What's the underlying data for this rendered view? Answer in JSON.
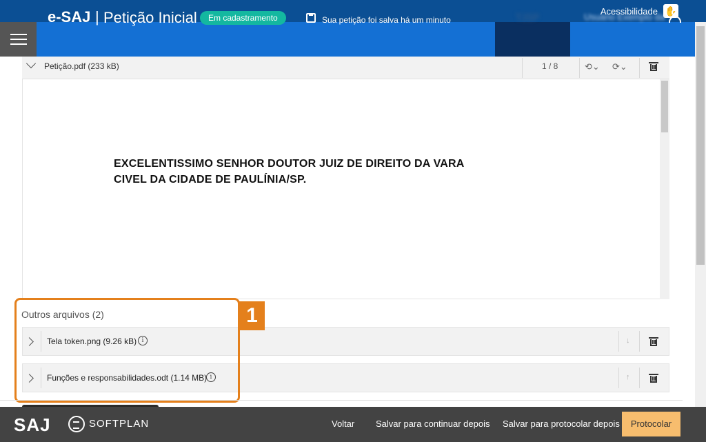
{
  "accessibility": {
    "label": "Acessibilidade",
    "icon": "hand-icon"
  },
  "header": {
    "brand": "e-SAJ",
    "separator": "|",
    "subtitle": "Petição Inicial",
    "status_badge": "Em cadastramento",
    "save_status": "Sua petição foi salva há um minuto",
    "court_label": "TJSP",
    "user_label": "Usuário Exemplo da"
  },
  "pdf": {
    "file_title": "Petição.pdf (233 kB)",
    "page_counter": "1 / 8",
    "content_lines": [
      "EXCELENTISSIMO SENHOR DOUTOR JUIZ DE DIREITO DA      VARA",
      "CIVEL DA CIDADE DE PAULÍNIA/SP."
    ]
  },
  "other_files": {
    "title": "Outros arquivos (2)",
    "items": [
      {
        "name": "Tela token.png (9.26 kB)",
        "move_icon": "arrow-down-icon"
      },
      {
        "name": "Funções e responsabilidades.odt (1.14 MB)",
        "move_icon": "arrow-up-icon"
      }
    ]
  },
  "annotation": {
    "number": "1",
    "color": "#e4801c"
  },
  "footer": {
    "logo_saj": "SAJ",
    "logo_softplan": "SOFTPLAN",
    "back": "Voltar",
    "save_continue": "Salvar para continuar depois",
    "save_protocol": "Salvar para protocolar depois",
    "protocol": "Protocolar"
  },
  "colors": {
    "top_strip": "#0b4f94",
    "header": "#1470d4",
    "badge": "#14b8a0",
    "footer": "#434343",
    "primary_action": "#f7bd6e"
  }
}
